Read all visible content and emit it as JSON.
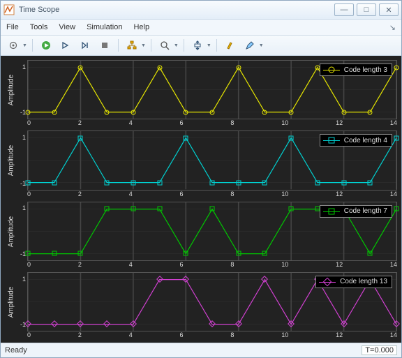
{
  "window": {
    "title": "Time Scope"
  },
  "winbtns": {
    "min": "—",
    "max": "□",
    "close": "✕"
  },
  "menu": {
    "file": "File",
    "tools": "Tools",
    "view": "View",
    "simulation": "Simulation",
    "help": "Help"
  },
  "toolbar_icons": [
    "gear",
    "play-green",
    "play-outline",
    "step",
    "stop",
    "hierarchy",
    "zoom",
    "autoscale",
    "highlight",
    "edit"
  ],
  "axes": {
    "ylabel": "Amplitude",
    "yticks": [
      1,
      -1
    ],
    "xticks": [
      0,
      2,
      4,
      6,
      8,
      10,
      12,
      14
    ]
  },
  "chart_data": [
    {
      "type": "line",
      "legend": "Code length 3",
      "color": "#e6e600",
      "marker": "circle",
      "x": [
        0,
        1,
        2,
        3,
        4,
        5,
        6,
        7,
        8,
        9,
        10,
        11,
        12,
        13,
        14
      ],
      "y": [
        -1,
        -1,
        1,
        -1,
        -1,
        1,
        -1,
        -1,
        1,
        -1,
        -1,
        1,
        -1,
        -1,
        1
      ],
      "xlabel": "",
      "ylabel": "Amplitude",
      "xlim": [
        0,
        14
      ],
      "ylim": [
        -1.3,
        1.3
      ]
    },
    {
      "type": "line",
      "legend": "Code length 4",
      "color": "#00d0d0",
      "marker": "square",
      "x": [
        0,
        1,
        2,
        3,
        4,
        5,
        6,
        7,
        8,
        9,
        10,
        11,
        12,
        13,
        14
      ],
      "y": [
        -1,
        -1,
        1,
        -1,
        -1,
        -1,
        1,
        -1,
        -1,
        -1,
        1,
        -1,
        -1,
        -1,
        1
      ],
      "xlabel": "",
      "ylabel": "Amplitude",
      "xlim": [
        0,
        14
      ],
      "ylim": [
        -1.3,
        1.3
      ]
    },
    {
      "type": "line",
      "legend": "Code length 7",
      "color": "#00c800",
      "marker": "square",
      "x": [
        0,
        1,
        2,
        3,
        4,
        5,
        6,
        7,
        8,
        9,
        10,
        11,
        12,
        13,
        14
      ],
      "y": [
        -1,
        -1,
        -1,
        1,
        1,
        1,
        -1,
        1,
        -1,
        -1,
        1,
        1,
        1,
        -1,
        1
      ],
      "xlabel": "",
      "ylabel": "Amplitude",
      "xlim": [
        0,
        14
      ],
      "ylim": [
        -1.3,
        1.3
      ]
    },
    {
      "type": "line",
      "legend": "Code length 13",
      "color": "#d040d0",
      "marker": "diamond",
      "x": [
        0,
        1,
        2,
        3,
        4,
        5,
        6,
        7,
        8,
        9,
        10,
        11,
        12,
        13,
        14
      ],
      "y": [
        -1,
        -1,
        -1,
        -1,
        -1,
        1,
        1,
        -1,
        -1,
        1,
        -1,
        1,
        -1,
        1,
        -1
      ],
      "xlabel": "",
      "ylabel": "Amplitude",
      "xlim": [
        0,
        14
      ],
      "ylim": [
        -1.3,
        1.3
      ]
    }
  ],
  "status": {
    "left": "Ready",
    "right": "T=0.000"
  }
}
